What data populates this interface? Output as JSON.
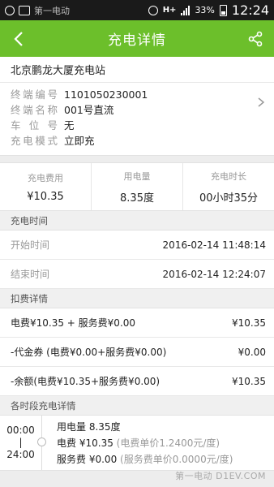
{
  "status_bar": {
    "left_text": "第一电动",
    "network": "H+",
    "battery": "33%",
    "time": "12:24"
  },
  "header": {
    "title": "充电详情",
    "back_icon": "back-arrow-icon",
    "share_icon": "share-icon"
  },
  "station": {
    "name": "北京鹏龙大厦充电站",
    "fields": [
      {
        "label": "终端编号",
        "value": "1101050230001"
      },
      {
        "label": "终端名称",
        "value": "001号直流"
      },
      {
        "label": "车位号",
        "value": "无"
      },
      {
        "label": "充电模式",
        "value": "立即充"
      }
    ]
  },
  "stats": [
    {
      "label": "充电费用",
      "value": "¥10.35"
    },
    {
      "label": "用电量",
      "value": "8.35度"
    },
    {
      "label": "充电时长",
      "value": "00小时35分"
    }
  ],
  "charge_time": {
    "title": "充电时间",
    "rows": [
      {
        "label": "开始时间",
        "value": "2016-02-14 11:48:14"
      },
      {
        "label": "结束时间",
        "value": "2016-02-14 12:24:07"
      }
    ]
  },
  "deduction": {
    "title": "扣费详情",
    "rows": [
      {
        "label": "电费¥10.35 + 服务费¥0.00",
        "value": "¥10.35"
      },
      {
        "label": "-代金券 (电费¥0.00+服务费¥0.00)",
        "value": "¥0.00"
      },
      {
        "label": "-余额(电费¥10.35+服务费¥0.00)",
        "value": "¥10.35"
      }
    ]
  },
  "segments": {
    "title": "各时段充电详情",
    "items": [
      {
        "start": "00:00",
        "sep": "|",
        "end": "24:00",
        "energy_label": "用电量",
        "energy_value": "8.35度",
        "fee_label": "电费",
        "fee_value": "¥10.35",
        "fee_unit": "(电费单价1.2400元/度)",
        "service_label": "服务费",
        "service_value": "¥0.00",
        "service_unit": "(服务费单价0.0000元/度)"
      }
    ]
  },
  "watermark": "第一电动 D1EV.COM"
}
